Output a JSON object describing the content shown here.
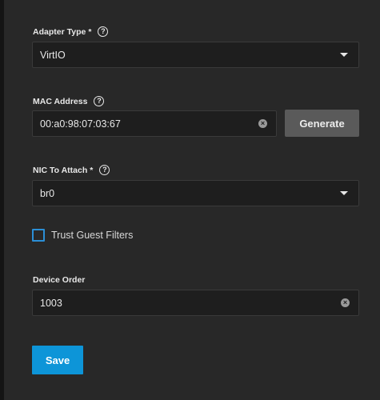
{
  "adapter_type": {
    "label": "Adapter Type",
    "required_mark": "*",
    "help_icon": "help-circle-icon",
    "value": "VirtIO"
  },
  "mac_address": {
    "label": "MAC Address",
    "help_icon": "help-circle-icon",
    "value": "00:a0:98:07:03:67",
    "generate_label": "Generate"
  },
  "nic_to_attach": {
    "label": "NIC To Attach",
    "required_mark": "*",
    "help_icon": "help-circle-icon",
    "value": "br0"
  },
  "trust_guest_filters": {
    "label": "Trust Guest Filters",
    "checked": false
  },
  "device_order": {
    "label": "Device Order",
    "value": "1003"
  },
  "save_label": "Save",
  "colors": {
    "panel_bg": "#282828",
    "field_bg": "#1e1e1e",
    "accent": "#0d95d8",
    "checkbox_border": "#2b8fd6",
    "generate_bg": "#5a5a5a"
  }
}
